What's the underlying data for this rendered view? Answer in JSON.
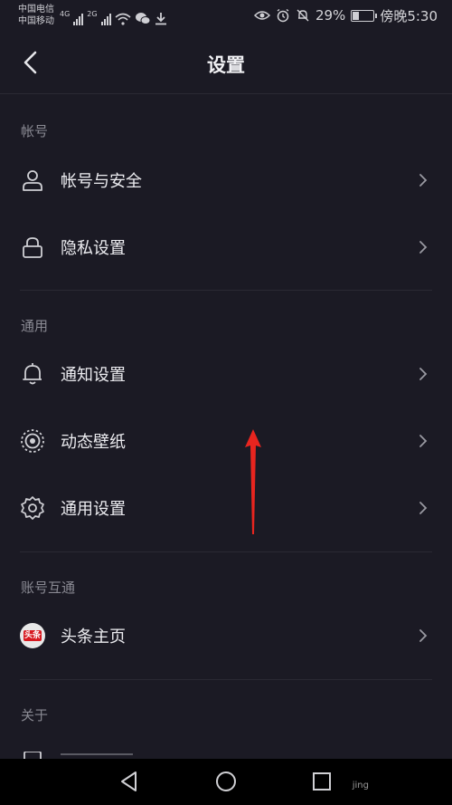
{
  "status_bar": {
    "carrier_1": "中国电信",
    "carrier_2": "中国移动",
    "net_1": "4G",
    "net_2": "2G",
    "battery_percent": "29%",
    "time": "傍晚5:30"
  },
  "header": {
    "title": "设置"
  },
  "sections": [
    {
      "label": "帐号",
      "items": [
        {
          "label": "帐号与安全",
          "icon": "user-icon"
        },
        {
          "label": "隐私设置",
          "icon": "lock-icon"
        }
      ]
    },
    {
      "label": "通用",
      "items": [
        {
          "label": "通知设置",
          "icon": "bell-icon"
        },
        {
          "label": "动态壁纸",
          "icon": "live-wallpaper-icon"
        },
        {
          "label": "通用设置",
          "icon": "gear-icon"
        }
      ]
    },
    {
      "label": "账号互通",
      "items": [
        {
          "label": "头条主页",
          "icon": "toutiao-logo",
          "logo_text": "头条"
        }
      ]
    },
    {
      "label": "关于",
      "items": []
    }
  ],
  "watermark": "jing",
  "colors": {
    "background": "#1b1a24",
    "arrow": "#e8251f",
    "text": "#ececf0",
    "section_label": "#8a8a93"
  }
}
